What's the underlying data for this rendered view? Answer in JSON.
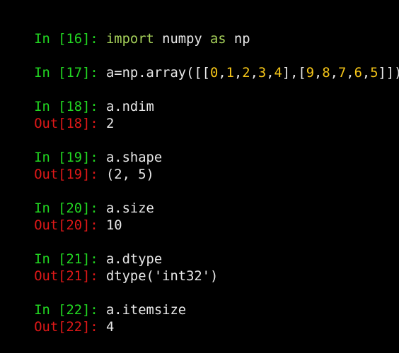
{
  "colors": {
    "background": "#000000",
    "in_prompt": "#22d822",
    "out_prompt": "#e01818",
    "text": "#e8e8e8",
    "keyword": "#a6d15a",
    "number": "#f5c518"
  },
  "cells": [
    {
      "in_prompt": "In [16]: ",
      "input_tokens": [
        {
          "text": "import",
          "kind": "kw"
        },
        {
          "text": " numpy ",
          "kind": "code"
        },
        {
          "text": "as",
          "kind": "kw"
        },
        {
          "text": " np",
          "kind": "code"
        }
      ]
    },
    {
      "in_prompt": "In [17]: ",
      "input_tokens": [
        {
          "text": "a=np.array([[",
          "kind": "code"
        },
        {
          "text": "0",
          "kind": "num"
        },
        {
          "text": ",",
          "kind": "code"
        },
        {
          "text": "1",
          "kind": "num"
        },
        {
          "text": ",",
          "kind": "code"
        },
        {
          "text": "2",
          "kind": "num"
        },
        {
          "text": ",",
          "kind": "code"
        },
        {
          "text": "3",
          "kind": "num"
        },
        {
          "text": ",",
          "kind": "code"
        },
        {
          "text": "4",
          "kind": "num"
        },
        {
          "text": "],[",
          "kind": "code"
        },
        {
          "text": "9",
          "kind": "num"
        },
        {
          "text": ",",
          "kind": "code"
        },
        {
          "text": "8",
          "kind": "num"
        },
        {
          "text": ",",
          "kind": "code"
        },
        {
          "text": "7",
          "kind": "num"
        },
        {
          "text": ",",
          "kind": "code"
        },
        {
          "text": "6",
          "kind": "num"
        },
        {
          "text": ",",
          "kind": "code"
        },
        {
          "text": "5",
          "kind": "num"
        },
        {
          "text": "]])",
          "kind": "code"
        }
      ]
    },
    {
      "in_prompt": "In [18]: ",
      "input_tokens": [
        {
          "text": "a.ndim",
          "kind": "code"
        }
      ],
      "out_prompt": "Out[18]: ",
      "output": "2"
    },
    {
      "in_prompt": "In [19]: ",
      "input_tokens": [
        {
          "text": "a.shape",
          "kind": "code"
        }
      ],
      "out_prompt": "Out[19]: ",
      "output": "(2, 5)"
    },
    {
      "in_prompt": "In [20]: ",
      "input_tokens": [
        {
          "text": "a.size",
          "kind": "code"
        }
      ],
      "out_prompt": "Out[20]: ",
      "output": "10"
    },
    {
      "in_prompt": "In [21]: ",
      "input_tokens": [
        {
          "text": "a.dtype",
          "kind": "code"
        }
      ],
      "out_prompt": "Out[21]: ",
      "output": "dtype('int32')"
    },
    {
      "in_prompt": "In [22]: ",
      "input_tokens": [
        {
          "text": "a.itemsize",
          "kind": "code"
        }
      ],
      "out_prompt": "Out[22]: ",
      "output": "4"
    }
  ]
}
